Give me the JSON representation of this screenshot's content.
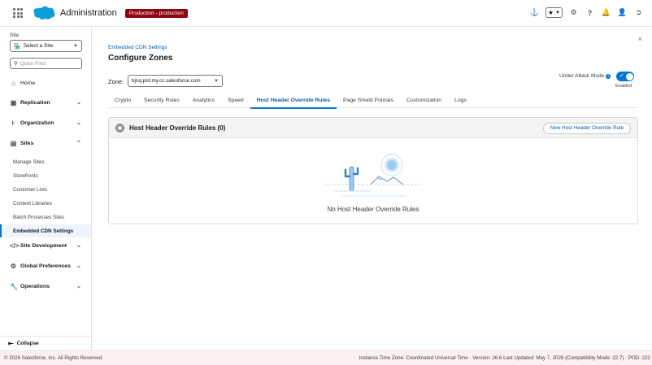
{
  "header": {
    "app_title": "Administration",
    "env_badge": "Production - production"
  },
  "sidebar": {
    "site_label": "Site",
    "site_select_value": "Select a Site",
    "quick_find_placeholder": "Quick Find",
    "home": "Home",
    "replication": "Replication",
    "organization": "Organization",
    "sites": "Sites",
    "sub_items": [
      "Manage Sites",
      "Storefronts",
      "Customer Lists",
      "Content Libraries",
      "Batch Processes Sites",
      "Embedded CDN Settings"
    ],
    "site_development": "Site Development",
    "global_preferences": "Global Preferences",
    "operations": "Operations",
    "collapse": "Collapse"
  },
  "main": {
    "breadcrumb": "Embedded CDN Settings",
    "title": "Configure Zones",
    "zone_label": "Zone:",
    "zone_value": "bjnq.prd.my.cc.salesforce.com",
    "attack_mode_label": "Under Attack Mode",
    "attack_mode_state": "Enabled",
    "tabs": [
      "Crypto",
      "Security Rules",
      "Analytics",
      "Speed",
      "Host Header Override Rules",
      "Page Shield Policies",
      "Customization",
      "Logs"
    ],
    "card_title": "Host Header Override Rules (0)",
    "new_rule_button": "New Host Header Override Rule",
    "empty_text": "No Host Header Override Rules"
  },
  "footer": {
    "copyright": "© 2026 Salesforce, Inc. All Rights Reserved.",
    "info": "Instance Time Zone: Coordinated Universal Time  ·  Version: 26.6 Last Updated: May 7, 2026 (Compatibility Mode: 22.7)  ·  POD: 222"
  },
  "colors": {
    "brand_blue": "#0176d3",
    "env_badge": "#8e030f",
    "footer_bg": "#fdf1f0"
  }
}
